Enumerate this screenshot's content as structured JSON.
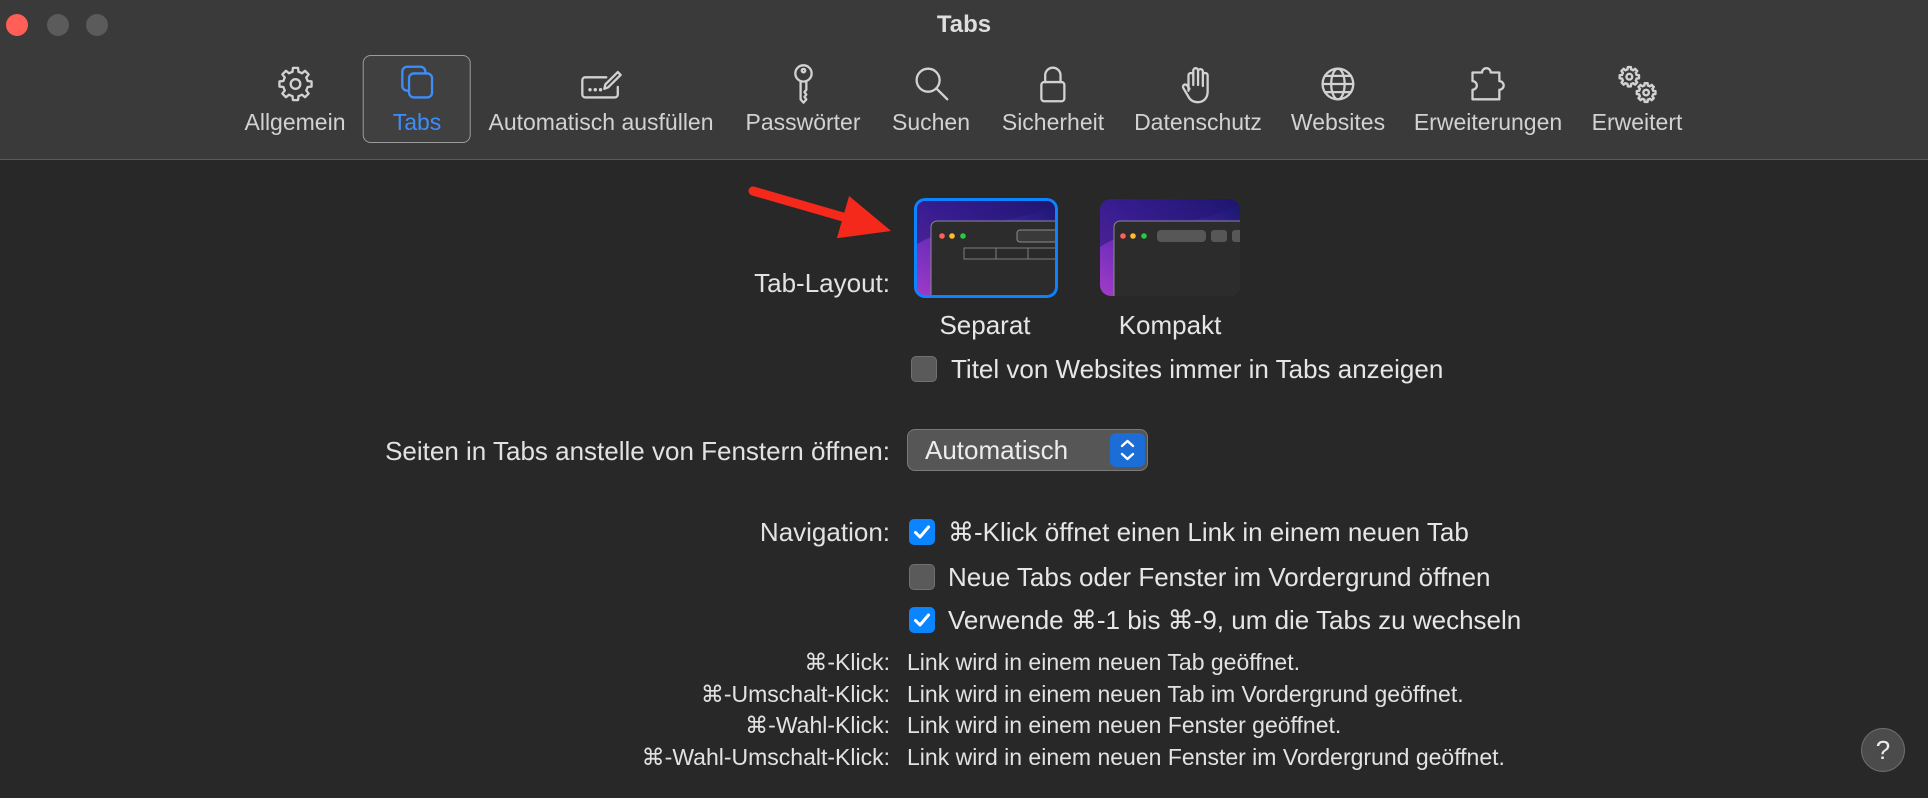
{
  "window": {
    "title": "Tabs"
  },
  "toolbar": {
    "items": [
      {
        "label": "Allgemein",
        "icon": "gear-icon",
        "selected": false
      },
      {
        "label": "Tabs",
        "icon": "tabs-icon",
        "selected": true
      },
      {
        "label": "Automatisch ausfüllen",
        "icon": "autofill-icon",
        "selected": false
      },
      {
        "label": "Passwörter",
        "icon": "key-icon",
        "selected": false
      },
      {
        "label": "Suchen",
        "icon": "search-icon",
        "selected": false
      },
      {
        "label": "Sicherheit",
        "icon": "lock-icon",
        "selected": false
      },
      {
        "label": "Datenschutz",
        "icon": "hand-icon",
        "selected": false
      },
      {
        "label": "Websites",
        "icon": "globe-icon",
        "selected": false
      },
      {
        "label": "Erweiterungen",
        "icon": "puzzle-icon",
        "selected": false
      },
      {
        "label": "Erweitert",
        "icon": "gears-icon",
        "selected": false
      }
    ]
  },
  "tab_layout": {
    "label": "Tab-Layout:",
    "options": [
      {
        "label": "Separat",
        "selected": true
      },
      {
        "label": "Kompakt",
        "selected": false
      }
    ],
    "always_show_titles": {
      "label": "Titel von Websites immer in Tabs anzeigen",
      "checked": false
    }
  },
  "open_pages_in_tabs": {
    "label": "Seiten in Tabs anstelle von Fenstern öffnen:",
    "value": "Automatisch"
  },
  "navigation": {
    "label": "Navigation:",
    "options": [
      {
        "label": "⌘-Klick öffnet einen Link in einem neuen Tab",
        "checked": true
      },
      {
        "label": "Neue Tabs oder Fenster im Vordergrund öffnen",
        "checked": false
      },
      {
        "label": "Verwende ⌘-1 bis ⌘-9, um die Tabs zu wechseln",
        "checked": true
      }
    ]
  },
  "shortcuts": [
    {
      "key": "⌘-Klick:",
      "description": "Link wird in einem neuen Tab geöffnet."
    },
    {
      "key": "⌘-Umschalt-Klick:",
      "description": "Link wird in einem neuen Tab im Vordergrund geöffnet."
    },
    {
      "key": "⌘-Wahl-Klick:",
      "description": "Link wird in einem neuen Fenster geöffnet."
    },
    {
      "key": "⌘-Wahl-Umschalt-Klick:",
      "description": "Link wird in einem neuen Fenster im Vordergrund geöffnet."
    }
  ],
  "help": {
    "label": "?"
  },
  "colors": {
    "accent": "#0a84ff",
    "close_button": "#ff5f57",
    "annotation_arrow": "#f5291b",
    "selected_toolbar_item": "#3d8ef8"
  }
}
